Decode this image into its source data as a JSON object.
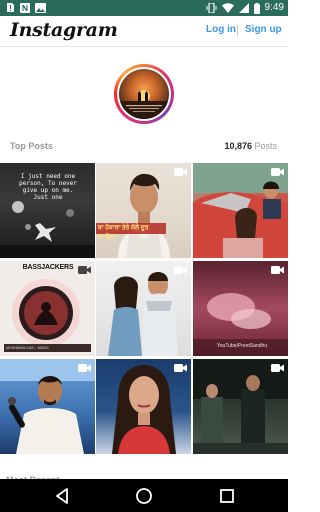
{
  "status_bar": {
    "time": "9:49",
    "bg_color": "#2a6b5b",
    "left_icons": [
      "sim-card-alert-icon",
      "notification-n-icon",
      "photo-icon"
    ],
    "right_icons": [
      "vibrate-icon",
      "wifi-icon",
      "signal-icon",
      "battery-icon"
    ]
  },
  "header": {
    "brand": "Instagram",
    "login_label": "Log in",
    "signup_label": "Sign up",
    "link_color": "#3897f0"
  },
  "profile": {
    "avatar_icon": "sunset-couple-avatar"
  },
  "top_posts": {
    "label": "Top Posts",
    "count": "10,876",
    "count_suffix": "Posts"
  },
  "posts": [
    {
      "caption": "I just need one\nperson, To never\ngive up on me.\nJust one",
      "video": false
    },
    {
      "caption": "ਬਾ ਹੋਕਾਰਾ ਤੇਰੇ ਕੋਲੇ ਦੂਰ\nਦਾ ਫ਼ੁੱਕਾ",
      "video": true
    },
    {
      "caption": "",
      "video": true
    },
    {
      "caption": "BASSJACKERS",
      "sub": "MOSHIMAN·DAS...·MUSIC",
      "video": true
    },
    {
      "caption": "",
      "video": true
    },
    {
      "caption": "YouTube/PreetSandhu",
      "video": true
    },
    {
      "caption": "",
      "video": true
    },
    {
      "caption": "",
      "video": true
    },
    {
      "caption": "",
      "video": true
    }
  ],
  "most_recent": {
    "label": "Most Recent"
  },
  "nav_bar": {
    "buttons": [
      "back-icon",
      "home-icon",
      "recents-icon"
    ]
  }
}
